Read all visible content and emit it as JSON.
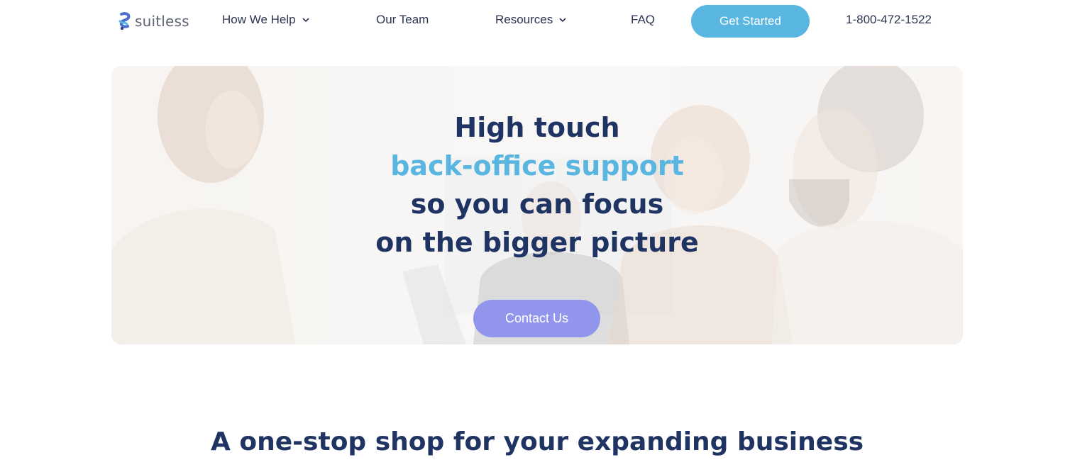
{
  "nav": {
    "logo_text": "suitless",
    "items": [
      {
        "label": "How We Help",
        "has_dropdown": true
      },
      {
        "label": "Our Team",
        "has_dropdown": false
      },
      {
        "label": "Resources",
        "has_dropdown": true
      },
      {
        "label": "FAQ",
        "has_dropdown": false
      }
    ],
    "cta_label": "Get Started",
    "phone": "1-800-472-1522"
  },
  "hero": {
    "line1": "High touch",
    "line2": "back-office support",
    "line3": "so you can focus",
    "line4": "on the bigger picture",
    "button_label": "Contact Us"
  },
  "section": {
    "title": "A one-stop shop for your expanding business"
  },
  "colors": {
    "navy": "#1f3463",
    "sky": "#59b6e1",
    "lavender": "#9196ec",
    "nav_text": "#2c3553"
  },
  "icons": {
    "logo": "suitless-logo-icon",
    "dropdown": "chevron-down-icon"
  }
}
